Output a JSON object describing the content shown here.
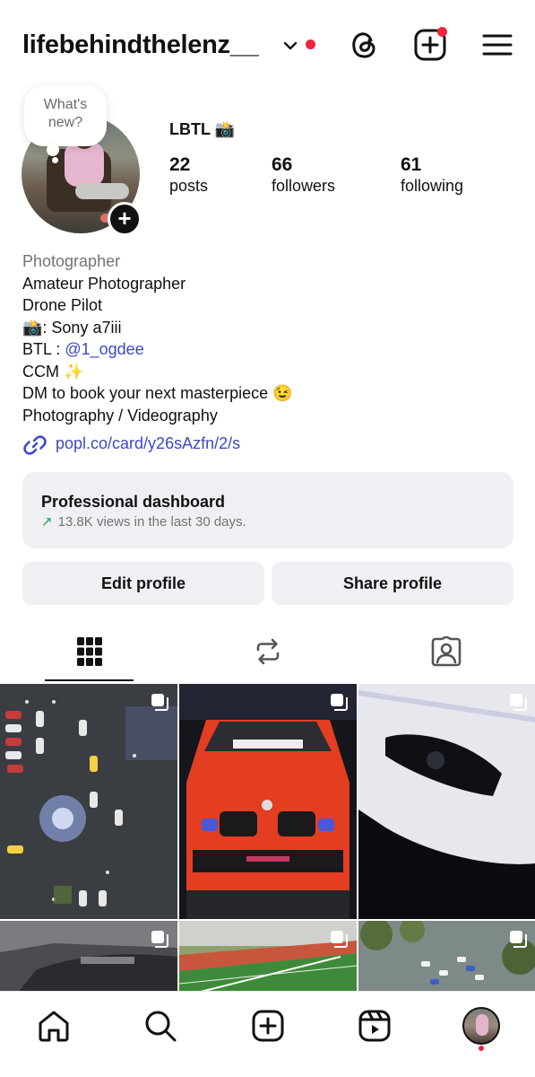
{
  "header": {
    "username": "lifebehindthelenz__",
    "icons": [
      "chevron-down-icon",
      "threads-icon",
      "create-post-icon",
      "menu-icon"
    ]
  },
  "profile": {
    "note_bubble": [
      "What's",
      "new?"
    ],
    "display_name": "LBTL 📸",
    "stats": [
      {
        "num": "22",
        "label": "posts"
      },
      {
        "num": "66",
        "label": "followers"
      },
      {
        "num": "61",
        "label": "following"
      }
    ]
  },
  "bio": {
    "category": "Photographer",
    "line1": "Amateur Photographer",
    "line2": "Drone Pilot",
    "line3": "📸: Sony a7iii",
    "line4_prefix": "BTL : ",
    "line4_mention": "@1_ogdee",
    "line5": "CCM ✨",
    "line6": "DM to book your next masterpiece 😉",
    "line7": "Photography / Videography",
    "link": "popl.co/card/y26sAzfn/2/s"
  },
  "dashboard": {
    "title": "Professional dashboard",
    "arrow": "↗",
    "subtitle": "13.8K views in the last 30 days."
  },
  "buttons": {
    "edit": "Edit profile",
    "share": "Share profile"
  },
  "tabs": [
    "grid-icon",
    "reposts-icon",
    "tagged-icon"
  ],
  "grid": [
    {
      "name": "post-aerial-parking-lot"
    },
    {
      "name": "post-orange-bmw"
    },
    {
      "name": "post-white-viper"
    },
    {
      "name": "post-car-hood"
    },
    {
      "name": "post-football-field"
    },
    {
      "name": "post-aerial-lot-trees"
    }
  ],
  "bottom_nav": [
    "home-icon",
    "search-icon",
    "create-icon",
    "reels-icon",
    "profile-avatar"
  ],
  "colors": {
    "link": "#3d49c6",
    "notification": "#f0243d",
    "button_bg": "#eff0f3",
    "trend_up": "#1f9e4a"
  }
}
